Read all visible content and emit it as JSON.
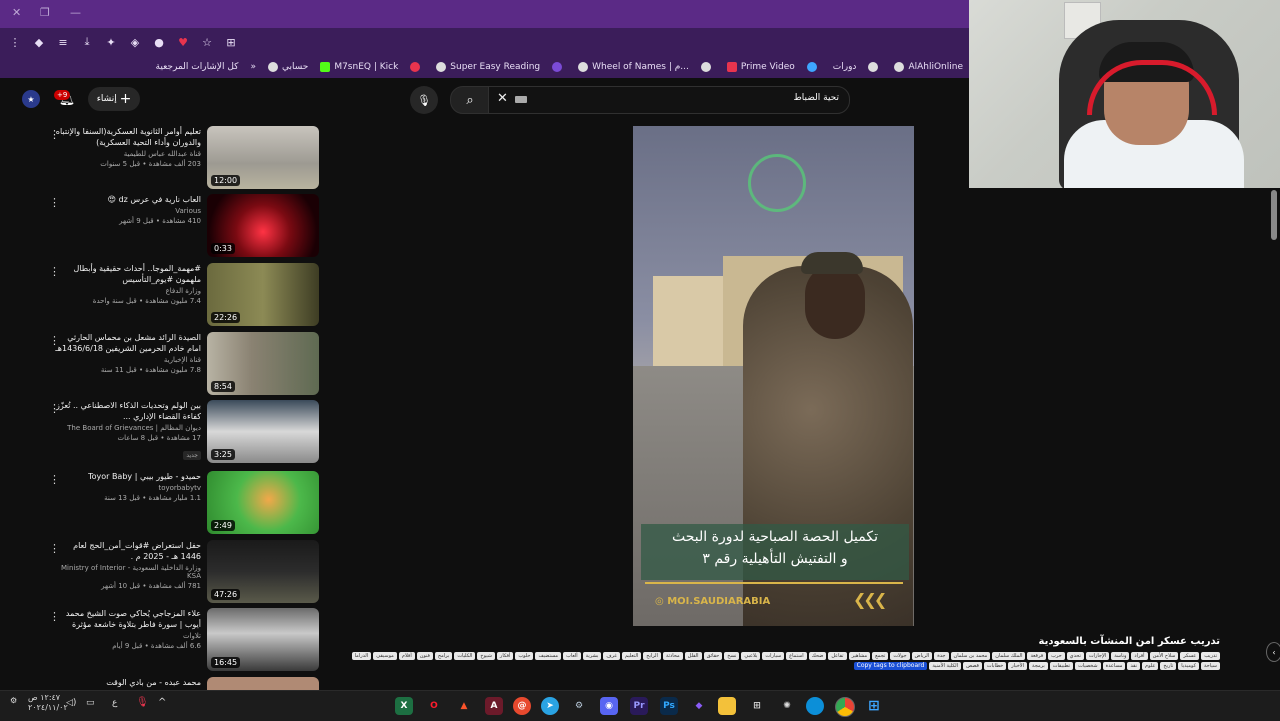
{
  "browser": {
    "bookmarks": [
      {
        "label": "AlAhliOnline"
      },
      {
        "label": ""
      },
      {
        "label": "دورات"
      },
      {
        "label": ""
      },
      {
        "label": "Prime Video"
      },
      {
        "label": ""
      },
      {
        "label": "Wheel of Names | م..."
      },
      {
        "label": ""
      },
      {
        "label": "Super Easy Reading"
      },
      {
        "label": ""
      },
      {
        "label": "M7snEQ | Kick"
      },
      {
        "label": "حسابي"
      },
      {
        "label": "كل الإشارات المرجعية"
      }
    ],
    "overflow": "»"
  },
  "youtube": {
    "notif_count": "+9",
    "create_label": "إنشاء",
    "search_value": "تحية الضباط"
  },
  "recommendations": [
    {
      "title": "تعليم أوامر الثانوية العسكرية(السنفا والإنتباه والدوران وأداء التحية العسكرية)",
      "channel": "قناة عبدالله عباس للطيمية",
      "meta": "203 ألف مشاهدة • قبل 5 سنوات",
      "duration": "12:00"
    },
    {
      "title": "العاب نارية في عرس dz 😍",
      "channel": "Various",
      "meta": "410 مشاهدة • قبل 9 أشهر",
      "duration": "0:33"
    },
    {
      "title": "#مهمة_الموجا.. أحداث حقيقية وأبطال ملهمون #يوم_التأسيس",
      "channel": "وزارة الدفاع",
      "meta": "7.4 مليون مشاهدة • قبل سنة واحدة",
      "duration": "22:26"
    },
    {
      "title": "الصيدة الرائد مشعل بن محماس الحارثي امام خادم الحرمين الشريفين 1436/6/18هـ",
      "channel": "قناة الإخبارية",
      "meta": "7.8 مليون مشاهدة • قبل 11 سنة",
      "duration": "8:54"
    },
    {
      "title": "بين الولم وتحديات الذكاء الاصطناعي .. تُعزّز كفاءة القضاء الإداري ...",
      "channel": "ديوان المظالم | The Board of Grievances",
      "meta": "17 مشاهدة • قبل 8 ساعات",
      "badge": "جديد",
      "duration": "3:25"
    },
    {
      "title": "حميدو - طيور بيبي | Toyor Baby",
      "channel": "toyorbabytv",
      "meta": "1.1 مليار مشاهدة • قبل 13 سنة",
      "duration": "2:49"
    },
    {
      "title": "حفل استعراض #قوات_أمن_الحج لعام 1446 هـ - 2025 م .",
      "channel": "وزارة الداخلية السعودية - Ministry of Interior KSA",
      "meta": "781 ألف مشاهدة • قبل 10 أشهر",
      "duration": "47:26"
    },
    {
      "title": "علاء المزجاجي يُحاكي صوت الشيخ محمد أيوب | سورة فاطر بتلاوة خاشعة مؤثرة",
      "channel": "تلاوات",
      "meta": "6.6 ألف مشاهدة • قبل 9 أيام",
      "duration": "16:45"
    },
    {
      "title": "محمد عبده - من بادي الوقت",
      "channel": "",
      "meta": "",
      "duration": ""
    }
  ],
  "video": {
    "caption_line1": "تكميل الحصة الصباحية لدورة البحث",
    "caption_line2": "و التفتيش التأهيلية رقم ٣",
    "watermark": "MOI.SAUDIARABIA",
    "chevrons": "❮❮❮",
    "title": "تدريب عسكر امن المنشآت بالسعودية",
    "copy_tags": "Copy tags to clipboard",
    "tags": [
      "تدريب",
      "عسكر",
      "سلاح الأمن",
      "أفراد",
      "وناسة",
      "الإجازات",
      "تحدي",
      "حرب",
      "فرقعة",
      "الملك سلمان",
      "محمد بن سلمان",
      "جدة",
      "الرياض",
      "جولات",
      "تجمع",
      "مشاهير",
      "تفاعل",
      "ضحك",
      "استماع",
      "سيارات",
      "بلاعبي",
      "نسخ",
      "حقائق",
      "الفلل",
      "محادثة",
      "الرابح",
      "التعليم",
      "غرف",
      "بشرية",
      "ألعاب",
      "مستضيف",
      "حلوب",
      "أفكار",
      "شيوخ",
      "الكليات",
      "برامج",
      "فنون",
      "أفلام",
      "موسيقى",
      "الدراما",
      "سياحة",
      "كوميديا",
      "تاريخ",
      "علوم",
      "نقد",
      "مساعدة",
      "شخصيات",
      "تطبيقات",
      "برمجة",
      "الأخبار",
      "خطابات",
      "قصص",
      "الكلية الأمنية"
    ]
  },
  "taskbar": {
    "time": "١٢:٤٧ ص",
    "date": "٢٠٢٤/١١/٠٢",
    "lang": "ع"
  }
}
